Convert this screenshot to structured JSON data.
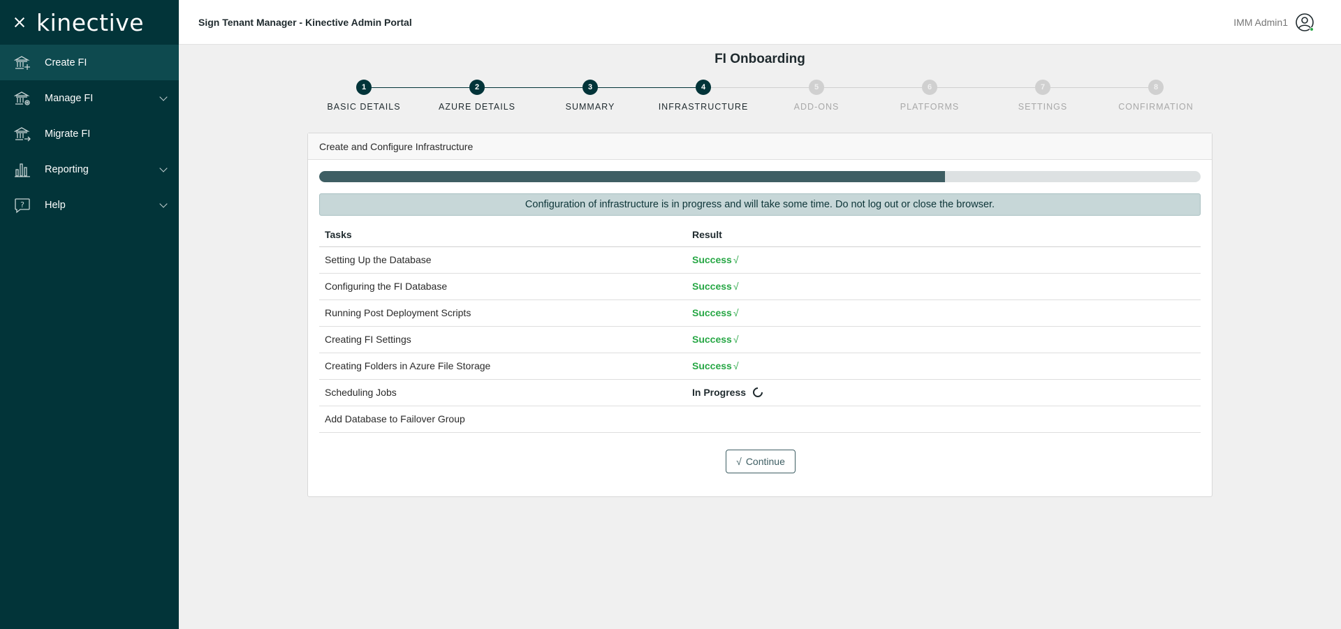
{
  "sidebar": {
    "logo_text": "kinective",
    "items": [
      {
        "label": "Create FI",
        "icon": "bank-plus-icon",
        "active": true,
        "expandable": false
      },
      {
        "label": "Manage FI",
        "icon": "bank-gear-icon",
        "active": false,
        "expandable": true
      },
      {
        "label": "Migrate FI",
        "icon": "bank-arrow-icon",
        "active": false,
        "expandable": false
      },
      {
        "label": "Reporting",
        "icon": "bar-chart-icon",
        "active": false,
        "expandable": true
      },
      {
        "label": "Help",
        "icon": "help-bubble-icon",
        "active": false,
        "expandable": true
      }
    ]
  },
  "header": {
    "title": "Sign Tenant Manager - Kinective Admin Portal",
    "user_name": "IMM Admin1"
  },
  "page": {
    "title": "FI Onboarding"
  },
  "stepper": {
    "steps": [
      {
        "number": "1",
        "label": "BASIC DETAILS",
        "state": "done"
      },
      {
        "number": "2",
        "label": "AZURE DETAILS",
        "state": "done"
      },
      {
        "number": "3",
        "label": "SUMMARY",
        "state": "done"
      },
      {
        "number": "4",
        "label": "INFRASTRUCTURE",
        "state": "done"
      },
      {
        "number": "5",
        "label": "ADD-ONS",
        "state": "todo"
      },
      {
        "number": "6",
        "label": "PLATFORMS",
        "state": "todo"
      },
      {
        "number": "7",
        "label": "SETTINGS",
        "state": "todo"
      },
      {
        "number": "8",
        "label": "CONFIRMATION",
        "state": "todo"
      }
    ]
  },
  "card": {
    "title": "Create and Configure Infrastructure",
    "progress_percent": 71,
    "alert": "Configuration of infrastructure is in progress and will take some time. Do not log out or close the browser.",
    "columns": [
      "Tasks",
      "Result"
    ],
    "tasks": [
      {
        "task": "Setting Up the Database",
        "result": "Success",
        "status": "success"
      },
      {
        "task": "Configuring the FI Database",
        "result": "Success",
        "status": "success"
      },
      {
        "task": "Running Post Deployment Scripts",
        "result": "Success",
        "status": "success"
      },
      {
        "task": "Creating FI Settings",
        "result": "Success",
        "status": "success"
      },
      {
        "task": "Creating Folders in Azure File Storage",
        "result": "Success",
        "status": "success"
      },
      {
        "task": "Scheduling Jobs",
        "result": "In Progress",
        "status": "in-progress"
      },
      {
        "task": "Add Database to Failover Group",
        "result": "",
        "status": "pending"
      }
    ],
    "continue_label": "Continue",
    "check_glyph": "√"
  },
  "colors": {
    "sidebar_bg": "#023439",
    "accent": "#3e5e63",
    "success": "#27a745"
  }
}
